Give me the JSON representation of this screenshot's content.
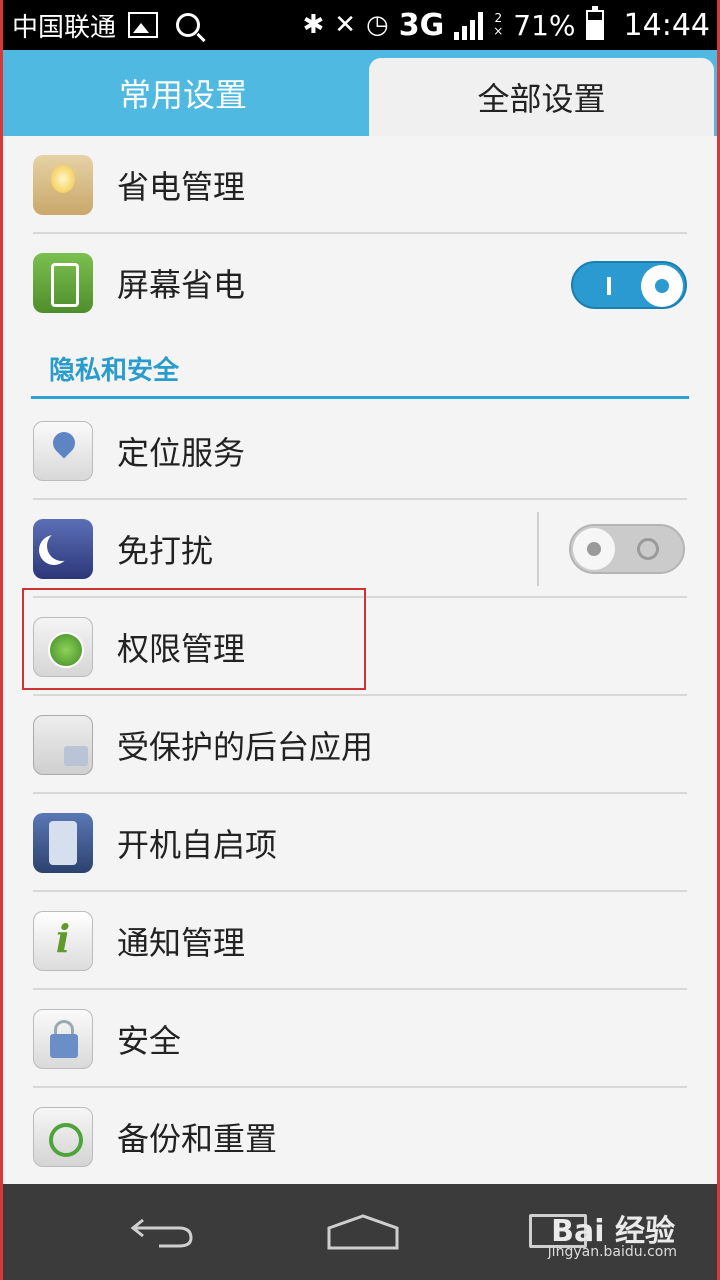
{
  "status_bar": {
    "carrier": "中国联通",
    "network": "3G",
    "sim": "2",
    "battery_percent": "71%",
    "battery_level": 0.71,
    "time": "14:44"
  },
  "tabs": {
    "common": "常用设置",
    "all": "全部设置",
    "active": "all"
  },
  "rows_top": [
    {
      "label": "省电管理",
      "icon": "lightbulb-icon"
    },
    {
      "label": "屏幕省电",
      "icon": "screen-power-icon",
      "toggle": "on"
    }
  ],
  "section": {
    "title": "隐私和安全"
  },
  "rows_privacy": [
    {
      "label": "定位服务",
      "icon": "location-pin-icon"
    },
    {
      "label": "免打扰",
      "icon": "moon-icon",
      "toggle": "off"
    },
    {
      "label": "权限管理",
      "icon": "keyhole-icon"
    },
    {
      "label": "受保护的后台应用",
      "icon": "protected-apps-icon"
    },
    {
      "label": "开机自启项",
      "icon": "phone-boot-icon"
    },
    {
      "label": "通知管理",
      "icon": "info-icon"
    },
    {
      "label": "安全",
      "icon": "padlock-icon"
    },
    {
      "label": "备份和重置",
      "icon": "backup-restore-icon"
    }
  ],
  "watermark": {
    "brand": "Bai 经验",
    "url": "jingyan.baidu.com"
  },
  "colors": {
    "accent": "#4fb9e1",
    "section": "#2a9ccc",
    "highlight": "#cc3333"
  }
}
